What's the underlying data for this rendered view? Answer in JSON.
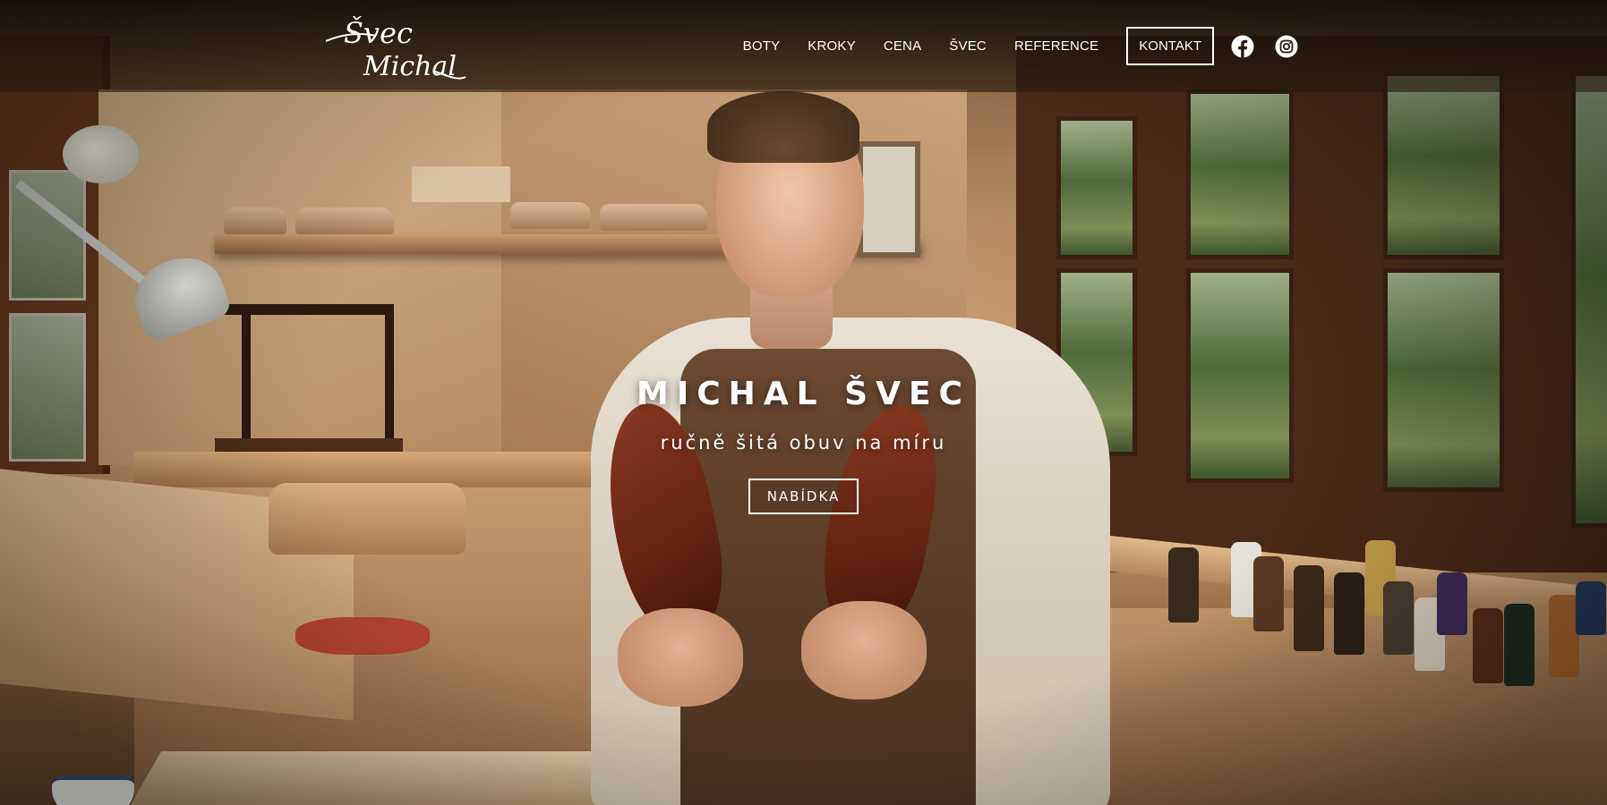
{
  "header": {
    "logo": {
      "line1": "Švec",
      "line2": "Michal"
    },
    "nav": [
      {
        "label": "BOTY"
      },
      {
        "label": "KROKY"
      },
      {
        "label": "CENA"
      },
      {
        "label": "ŠVEC"
      },
      {
        "label": "REFERENCE"
      }
    ],
    "contact_label": "KONTAKT",
    "social": [
      {
        "icon": "facebook-icon"
      },
      {
        "icon": "instagram-icon"
      }
    ]
  },
  "hero": {
    "title": "MICHAL ŠVEC",
    "subtitle": "ručně šitá obuv na míru",
    "button_label": "NABÍDKA"
  },
  "colors": {
    "text": "#ffffff",
    "header_bg": "#1e130a"
  }
}
